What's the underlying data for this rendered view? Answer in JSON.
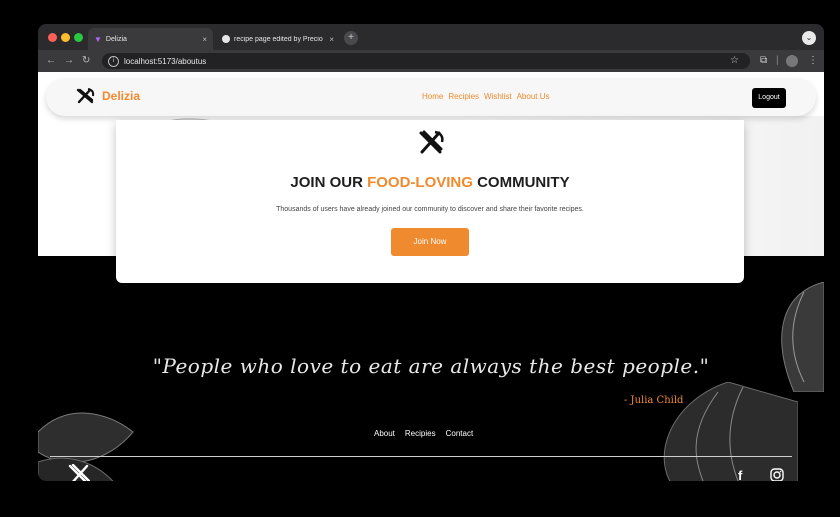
{
  "browser": {
    "tabs": [
      {
        "title": "Delizia",
        "active": true,
        "close": "×"
      },
      {
        "title": "recipe page edited by Precio",
        "active": false,
        "close": "×"
      }
    ],
    "newtab_label": "+",
    "url": "localhost:5173/aboutus",
    "colors": {
      "frame": "#2b2b2e",
      "toolbar": "#3a3a3d",
      "close": "#ff5f57",
      "minimize": "#febc2e",
      "maximize": "#28c840"
    }
  },
  "navbar": {
    "brand": "Delizia",
    "links": [
      "Home",
      "Recipies",
      "Wishlist",
      "About Us"
    ],
    "logout": "Logout"
  },
  "community": {
    "title_prefix": "JOIN OUR ",
    "title_accent": "FOOD-LOVING",
    "title_suffix": " COMMUNITY",
    "subtitle": "Thousands of users have already joined our community to discover and share their favorite recipes.",
    "cta": "Join Now"
  },
  "quote": {
    "text": "\"People who love to eat are always the best people.\"",
    "author": "- Julia Child"
  },
  "footer": {
    "links": [
      "About",
      "Recipies",
      "Contact"
    ],
    "social": [
      "facebook-icon",
      "instagram-icon"
    ]
  },
  "colors": {
    "accent": "#f08a2e",
    "dark": "#000000"
  }
}
